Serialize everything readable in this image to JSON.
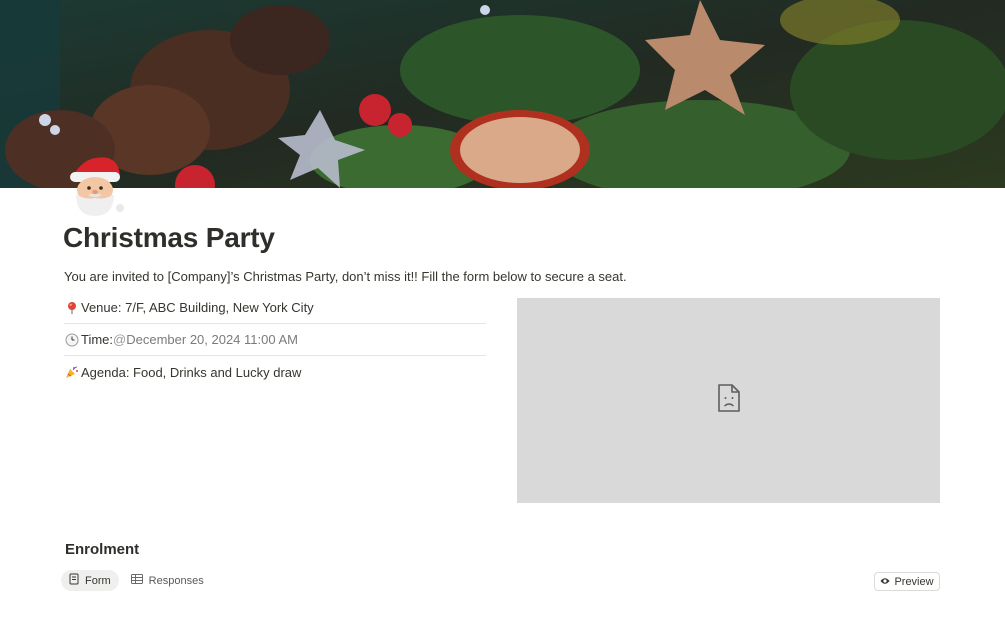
{
  "page": {
    "title": "Christmas Party",
    "intro": "You are invited to [Company]’s Christmas Party, don’t miss it!! Fill the form below to secure a seat."
  },
  "details": {
    "venue": {
      "icon": "round-pushpin-icon",
      "label": "Venue: 7/F, ABC Building, New York City"
    },
    "time": {
      "icon": "clock-icon",
      "label": "Time: ",
      "at": "@",
      "date": "December 20, 2024 11:00 AM"
    },
    "agenda": {
      "icon": "party-popper-icon",
      "label": "Agenda: Food, Drinks and Lucky draw"
    }
  },
  "embed": {
    "icon": "broken-file-icon"
  },
  "enrolment": {
    "title": "Enrolment",
    "tabs": [
      {
        "label": "Form",
        "icon": "form-icon",
        "active": true
      },
      {
        "label": "Responses",
        "icon": "table-icon",
        "active": false
      }
    ],
    "preview_label": "Preview"
  },
  "colors": {
    "embed_bg": "#d9d9d9",
    "text": "#37352f",
    "muted": "#7c7b78"
  }
}
